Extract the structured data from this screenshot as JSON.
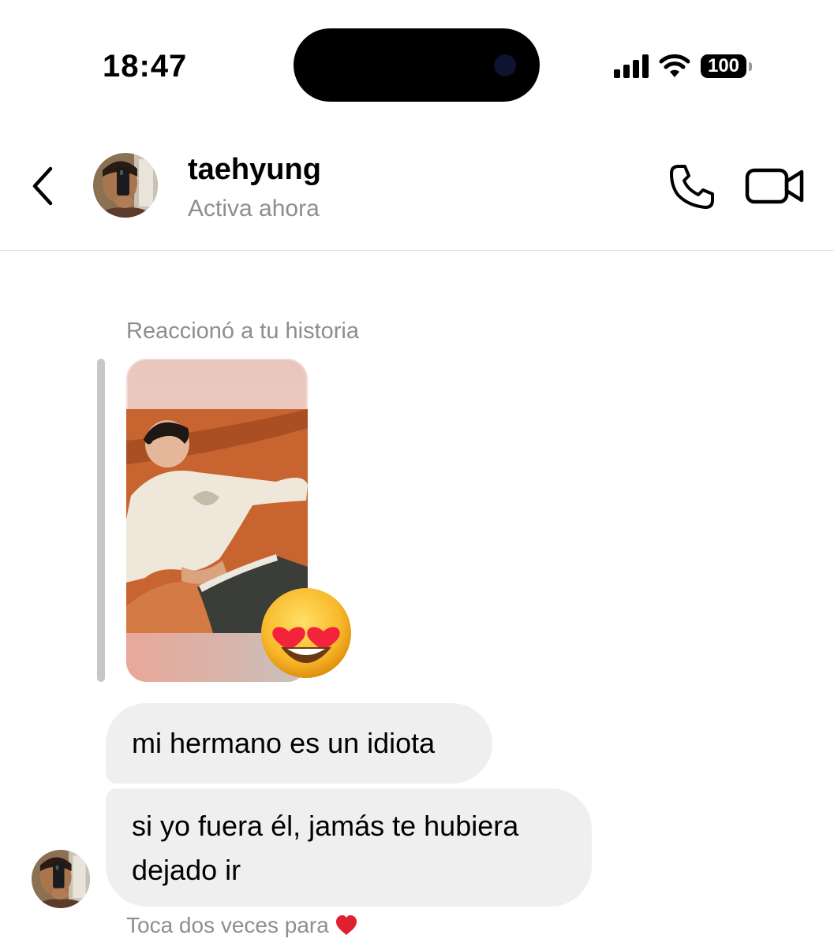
{
  "status_bar": {
    "time": "18:47",
    "battery": "100",
    "icons": [
      "cellular-signal-icon",
      "wifi-icon",
      "battery-icon"
    ]
  },
  "header": {
    "username": "taehyung",
    "status": "Activa ahora",
    "icons": [
      "back-chevron-icon",
      "phone-icon",
      "video-camera-icon"
    ]
  },
  "story_reaction": {
    "label": "Reaccionó a tu historia",
    "reaction_emoji": "smiling-face-with-heart-eyes"
  },
  "messages": [
    {
      "text": "mi hermano es un idiota"
    },
    {
      "text": "si yo fuera él, jamás te hubiera dejado ir"
    }
  ],
  "hint": {
    "text": "Toca dos veces para",
    "icon": "red-heart-icon",
    "color": "#e0202e"
  }
}
